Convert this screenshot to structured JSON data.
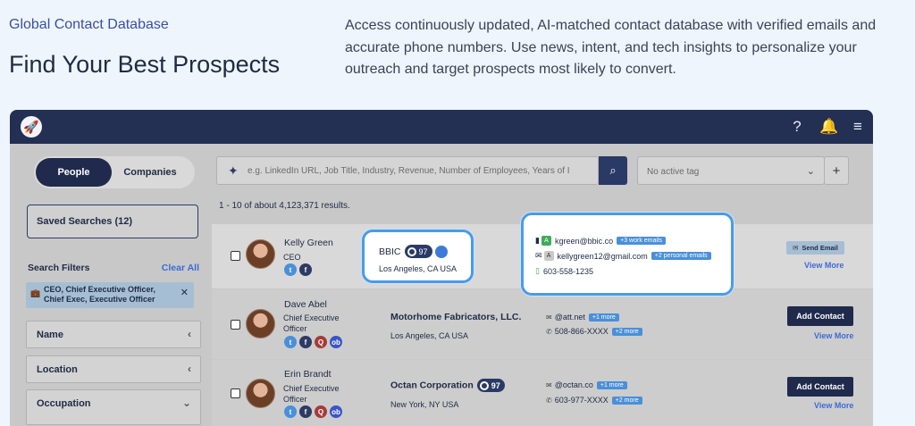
{
  "hero": {
    "eyebrow": "Global Contact Database",
    "title": "Find Your Best Prospects",
    "description": "Access continuously updated, AI-matched contact database with verified emails and accurate phone numbers. Use news, intent, and tech insights to personalize your outreach and target prospects most likely to convert."
  },
  "topbar": {
    "icons": [
      "rocket-icon",
      "help-icon",
      "bell-icon",
      "menu-icon"
    ],
    "help_glyph": "?",
    "bell_glyph": "🔔",
    "menu_glyph": "≡"
  },
  "sidebar": {
    "toggle": {
      "active": "People",
      "inactive": "Companies"
    },
    "saved_searches": "Saved Searches (12)",
    "filters_title": "Search Filters",
    "clear_all": "Clear All",
    "active_chip": "CEO, Chief Executive Officer, Chief Exec, Executive Officer",
    "filters": [
      "Name",
      "Location",
      "Occupation"
    ]
  },
  "search": {
    "placeholder": "e.g. LinkedIn URL, Job Title, Industry, Revenue, Number of Employees, Years of I"
  },
  "tag_select": {
    "value": "No active tag",
    "add": "+"
  },
  "results_count": "1 - 10 of about 4,123,371 results.",
  "rows": [
    {
      "name": "Kelly Green",
      "title": "CEO",
      "company": "BBIC",
      "score": "97",
      "location": "Los Angeles, CA USA",
      "work_email": "kgreen@bbic.co",
      "work_more": "+3 work emails",
      "personal_email": "kellygreen12@gmail.com",
      "personal_more": "+2 personal emails",
      "phone": "603-558-1235",
      "action": "Send Email",
      "view_more": "View More"
    },
    {
      "name": "Dave Abel",
      "title": "Chief Executive Officer",
      "company": "Motorhome Fabricators, LLC.",
      "location": "Los Angeles, CA USA",
      "email": "@att.net",
      "email_more": "+1 more",
      "phone": "508-866-XXXX",
      "phone_more": "+2 more",
      "action": "Add Contact",
      "view_more": "View More"
    },
    {
      "name": "Erin Brandt",
      "title": "Chief Executive Officer",
      "company": "Octan Corporation",
      "score": "97",
      "location": "New York, NY USA",
      "email": "@octan.co",
      "email_more": "+1 more",
      "phone": "603-977-XXXX",
      "phone_more": "+2 more",
      "action": "Add Contact",
      "view_more": "View More"
    }
  ],
  "colors": {
    "navy": "#232f53",
    "accent_blue": "#4a9be6",
    "link": "#3c6bd6"
  }
}
